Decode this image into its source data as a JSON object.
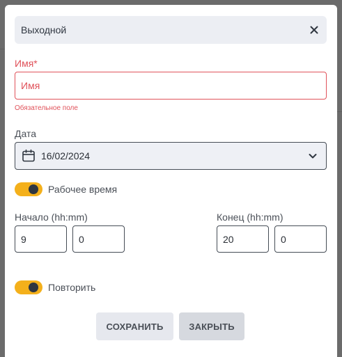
{
  "dialog": {
    "title": "Выходной",
    "close_icon": "close-icon"
  },
  "name_field": {
    "label": "Имя*",
    "placeholder": "Имя",
    "value": "",
    "error": "Обязательное поле"
  },
  "date_field": {
    "label": "Дата",
    "value": "16/02/2024",
    "icon": "calendar-icon",
    "dropdown_icon": "chevron-down-icon"
  },
  "work_time_toggle": {
    "label": "Рабочее время",
    "on": true
  },
  "start_time": {
    "label": "Начало (hh:mm)",
    "hours": "9",
    "minutes": "0"
  },
  "end_time": {
    "label": "Конец (hh:mm)",
    "hours": "20",
    "minutes": "0"
  },
  "repeat_toggle": {
    "label": "Повторить",
    "on": true
  },
  "buttons": {
    "save": "СОХРАНИТЬ",
    "close": "ЗАКРЫТЬ"
  },
  "colors": {
    "accent": "#f4b01b",
    "error": "#e0525a",
    "header_bg": "#eceef3",
    "button_bg": "#e6e8ee",
    "button_active_bg": "#d6d9df"
  }
}
